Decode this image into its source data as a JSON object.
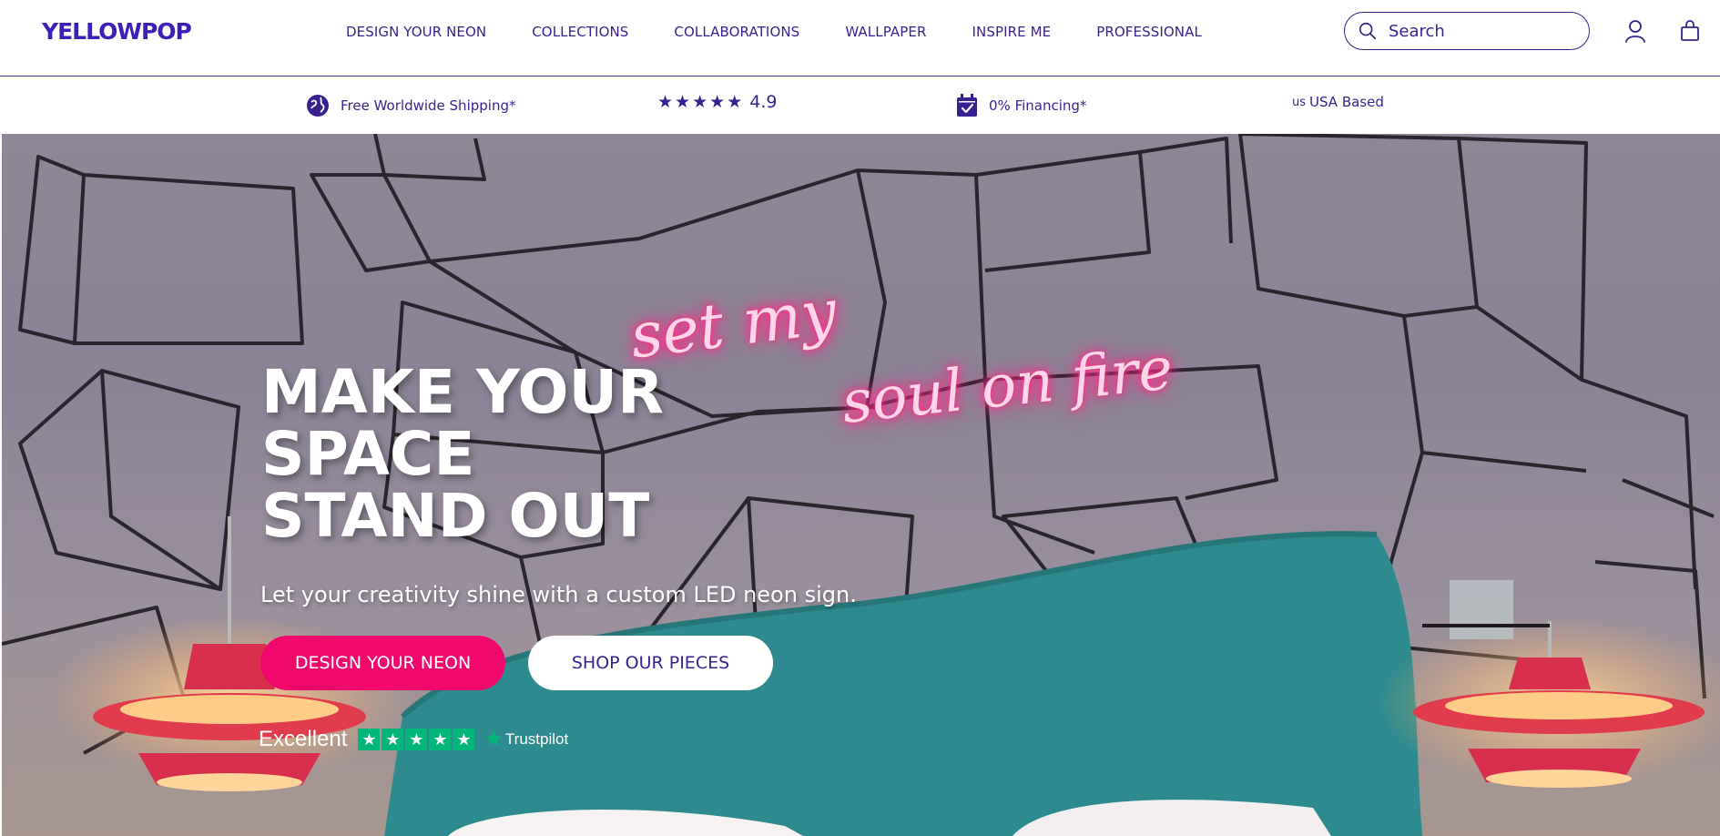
{
  "brand": {
    "logo_text": "YELLOWPOP"
  },
  "nav": {
    "items": [
      {
        "label": "DESIGN YOUR NEON"
      },
      {
        "label": "COLLECTIONS"
      },
      {
        "label": "COLLABORATIONS"
      },
      {
        "label": "WALLPAPER"
      },
      {
        "label": "INSPIRE ME"
      },
      {
        "label": "PROFESSIONAL"
      }
    ]
  },
  "search": {
    "placeholder": "Search",
    "icon": "search-icon"
  },
  "header_icons": {
    "account": "user-icon",
    "cart": "shopping-bag-icon"
  },
  "usp": {
    "shipping": {
      "label": "Free Worldwide Shipping*",
      "icon": "globe-icon"
    },
    "rating": {
      "value": "4.9",
      "stars": 5,
      "icon": "star-icon"
    },
    "financing": {
      "label": "0% Financing*",
      "icon": "calendar-check-icon"
    },
    "based": {
      "tag": "us",
      "label": "USA Based"
    }
  },
  "hero": {
    "headline_line1": "MAKE YOUR",
    "headline_line2": "SPACE",
    "headline_line3": "STAND OUT",
    "neon_line1": "set my",
    "neon_line2": "soul on fire",
    "subhead": "Let your creativity shine with a custom LED neon sign.",
    "primary_cta": "DESIGN YOUR NEON",
    "secondary_cta": "SHOP OUR PIECES",
    "trustpilot": {
      "rating_word": "Excellent",
      "stars": 5,
      "brand": "Trustpilot"
    }
  },
  "colors": {
    "brand_purple": "#3a1f8f",
    "cta_pink": "#f0086c",
    "trustpilot_green": "#00b67a",
    "neon_pink": "#ff2e8a"
  }
}
